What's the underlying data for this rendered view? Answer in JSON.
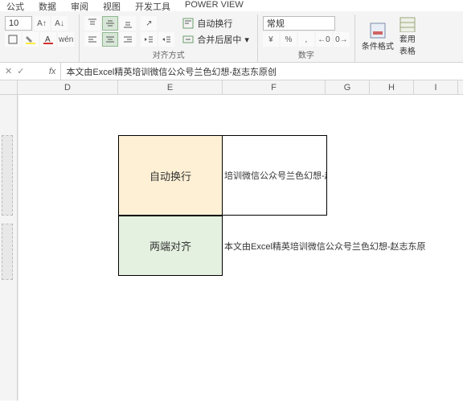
{
  "menu": {
    "items": [
      "公式",
      "数据",
      "审阅",
      "视图",
      "开发工具",
      "POWER VIEW"
    ]
  },
  "font": {
    "size": "10",
    "increase": "A",
    "decrease": "A"
  },
  "align": {
    "wrap_label": "自动换行",
    "merge_label": "合并后居中",
    "group_label": "对齐方式"
  },
  "number": {
    "format": "常规",
    "group_label": "数字"
  },
  "styles": {
    "cond_format": "条件格式",
    "table_style": "套用\n表格"
  },
  "formula_bar": {
    "text": "本文由Excel精英培训微信公众号兰色幻想-赵志东原创"
  },
  "columns": [
    "D",
    "E",
    "F",
    "G",
    "H",
    "I"
  ],
  "cells": {
    "e_yellow": "自动换行",
    "f_top": "培训微信公众号兰色幻想-赵志东原创",
    "e_green": "两端对齐",
    "f_bottom": "本文由Excel精英培训微信公众号兰色幻想-赵志东原"
  },
  "stars": "****"
}
